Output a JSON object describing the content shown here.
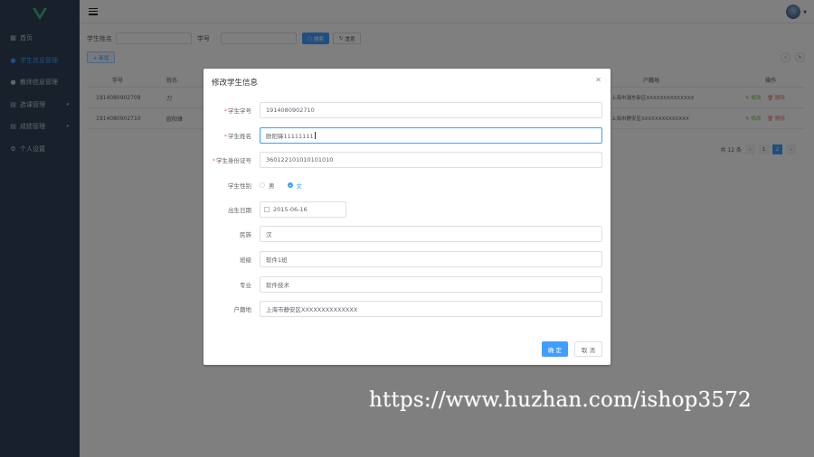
{
  "colors": {
    "sidebar_bg": "#304156",
    "sidebar_text": "#bfcbd9",
    "primary": "#409eff",
    "logo_green": "#41b883"
  },
  "sidebar": {
    "items": [
      {
        "label": "首页",
        "icon": "dashboard-icon"
      },
      {
        "label": "学生信息管理",
        "icon": "user-icon",
        "active": true
      },
      {
        "label": "教师信息管理",
        "icon": "person-icon"
      },
      {
        "label": "选课管理",
        "icon": "list-icon",
        "expandable": true
      },
      {
        "label": "成绩管理",
        "icon": "grade-icon",
        "expandable": true
      },
      {
        "label": "个人设置",
        "icon": "settings-icon"
      }
    ]
  },
  "search": {
    "name_label": "学生姓名",
    "id_label": "学号",
    "search_btn": "搜索",
    "reset_btn": "重置"
  },
  "toolbar": {
    "add_label": "+ 新增"
  },
  "table": {
    "headers": {
      "id": "学号",
      "name": "姓名",
      "addr": "户籍地",
      "op": "操作"
    },
    "rows": [
      {
        "id": "1914080902709",
        "name": "刀",
        "addr": "上海市浦东新区XXXXXXXXXXXXXX",
        "edit": "修改",
        "del": "删除"
      },
      {
        "id": "1914080902710",
        "name": "欧阳锋",
        "addr": "上海市静安区XXXXXXXXXXXXXX",
        "edit": "修改",
        "del": "删除"
      }
    ]
  },
  "pagination": {
    "total": "共 12 条",
    "prev": "‹",
    "next": "›",
    "pages": [
      "1",
      "2"
    ],
    "current": "2"
  },
  "dialog": {
    "title": "修改学生信息",
    "fields": {
      "student_id": {
        "label": "学生学号",
        "required": true,
        "value": "1914080902710"
      },
      "student_name": {
        "label": "学生姓名",
        "required": true,
        "value": "欧阳锋11111111"
      },
      "id_card": {
        "label": "学生身份证号",
        "required": true,
        "value": "360122101010101010"
      },
      "gender": {
        "label": "学生性别",
        "options": [
          "男",
          "女"
        ],
        "selected": "女"
      },
      "birth": {
        "label": "出生日期",
        "value": "2015-06-16"
      },
      "ethnicity": {
        "label": "民族",
        "value": "汉"
      },
      "class": {
        "label": "班级",
        "value": "软件1班"
      },
      "major": {
        "label": "专业",
        "value": "软件技术"
      },
      "address": {
        "label": "户籍地",
        "value": "上海市静安区XXXXXXXXXXXXXX"
      }
    },
    "ok": "确 定",
    "cancel": "取 消"
  },
  "watermark": "https://www.huzhan.com/ishop3572"
}
